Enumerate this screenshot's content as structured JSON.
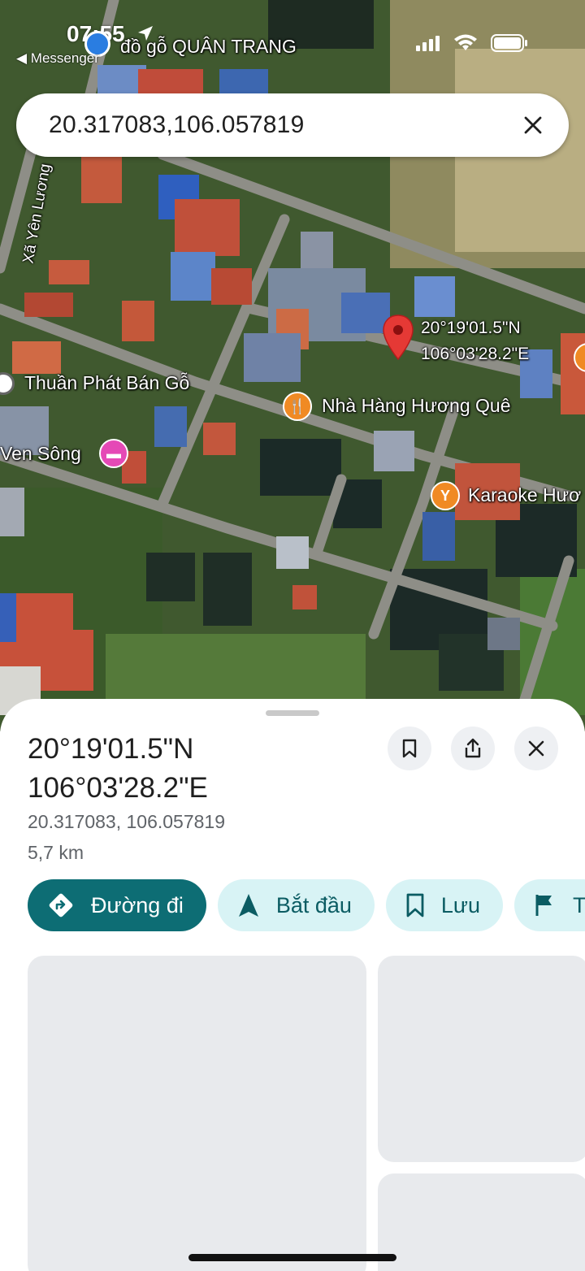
{
  "status_bar": {
    "time": "07:55",
    "back_app": "◀ Messenger"
  },
  "search": {
    "query": "20.317083,106.057819"
  },
  "map": {
    "labels": [
      {
        "text": "đồ gỗ QUÂN TRANG"
      },
      {
        "text": "Xã Yên Lương"
      },
      {
        "text": "Thuần Phát Bán Gỗ"
      },
      {
        "text": "Nhà Hàng Hương Quê"
      },
      {
        "text": "Ven Sông"
      },
      {
        "text": "Karaoke Hươ"
      }
    ],
    "pin_label_line1": "20°19'01.5\"N",
    "pin_label_line2": "106°03'28.2\"E"
  },
  "sheet": {
    "title_line1": "20°19'01.5\"N",
    "title_line2": "106°03'28.2\"E",
    "decimal_coords": "20.317083, 106.057819",
    "distance": "5,7 km",
    "actions": [
      {
        "label": "Đường đi",
        "icon": "directions-icon"
      },
      {
        "label": "Bắt đầu",
        "icon": "navigation-arrow-icon"
      },
      {
        "label": "Lưu",
        "icon": "bookmark-icon"
      },
      {
        "label": "T",
        "icon": "flag-icon"
      }
    ]
  },
  "colors": {
    "primary": "#0d6d74",
    "chip_bg": "#d8f3f5",
    "pin": "#e53935"
  }
}
